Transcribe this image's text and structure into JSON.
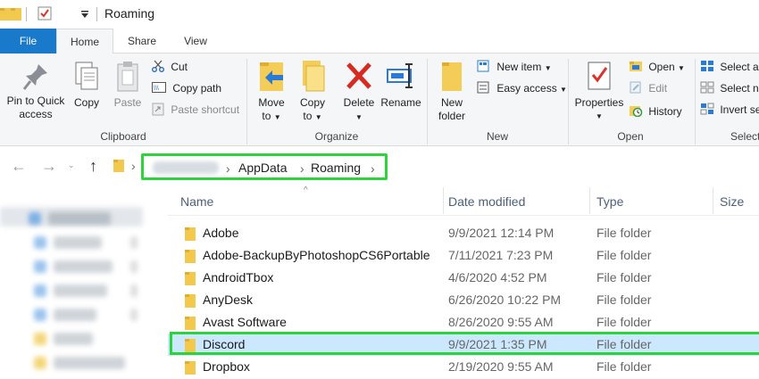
{
  "window": {
    "title": "Roaming"
  },
  "tabs": {
    "file": "File",
    "home": "Home",
    "share": "Share",
    "view": "View"
  },
  "ribbon": {
    "clipboard": {
      "label": "Clipboard",
      "pin_line1": "Pin to Quick",
      "pin_line2": "access",
      "copy": "Copy",
      "paste": "Paste",
      "cut": "Cut",
      "copy_path": "Copy path",
      "paste_shortcut": "Paste shortcut"
    },
    "organize": {
      "label": "Organize",
      "move_line1": "Move",
      "move_line2": "to",
      "copy_line1": "Copy",
      "copy_line2": "to",
      "delete": "Delete",
      "rename": "Rename"
    },
    "new": {
      "label": "New",
      "new_folder_line1": "New",
      "new_folder_line2": "folder",
      "new_item": "New item",
      "easy_access": "Easy access"
    },
    "open": {
      "label": "Open",
      "properties": "Properties",
      "open": "Open",
      "edit": "Edit",
      "history": "History"
    },
    "select": {
      "label": "Select",
      "select_all": "Select all",
      "select_none": "Select none",
      "invert": "Invert selection"
    }
  },
  "address": {
    "crumbs": [
      "AppData",
      "Roaming"
    ]
  },
  "columns": {
    "name": "Name",
    "date": "Date modified",
    "type": "Type",
    "size": "Size"
  },
  "files": [
    {
      "name": "Adobe",
      "date": "9/9/2021 12:14 PM",
      "type": "File folder"
    },
    {
      "name": "Adobe-BackupByPhotoshopCS6Portable",
      "date": "7/11/2021 7:23 PM",
      "type": "File folder"
    },
    {
      "name": "AndroidTbox",
      "date": "4/6/2020 4:52 PM",
      "type": "File folder"
    },
    {
      "name": "AnyDesk",
      "date": "6/26/2020 10:22 PM",
      "type": "File folder"
    },
    {
      "name": "Avast Software",
      "date": "8/26/2020 9:55 AM",
      "type": "File folder"
    },
    {
      "name": "Discord",
      "date": "9/9/2021 1:35 PM",
      "type": "File folder"
    },
    {
      "name": "Dropbox",
      "date": "2/19/2020 9:55 AM",
      "type": "File folder"
    }
  ],
  "colors": {
    "file_tab": "#1979ca",
    "highlight": "#2dd33a",
    "selection": "#cce8ff",
    "folder": "#f2c94c"
  }
}
